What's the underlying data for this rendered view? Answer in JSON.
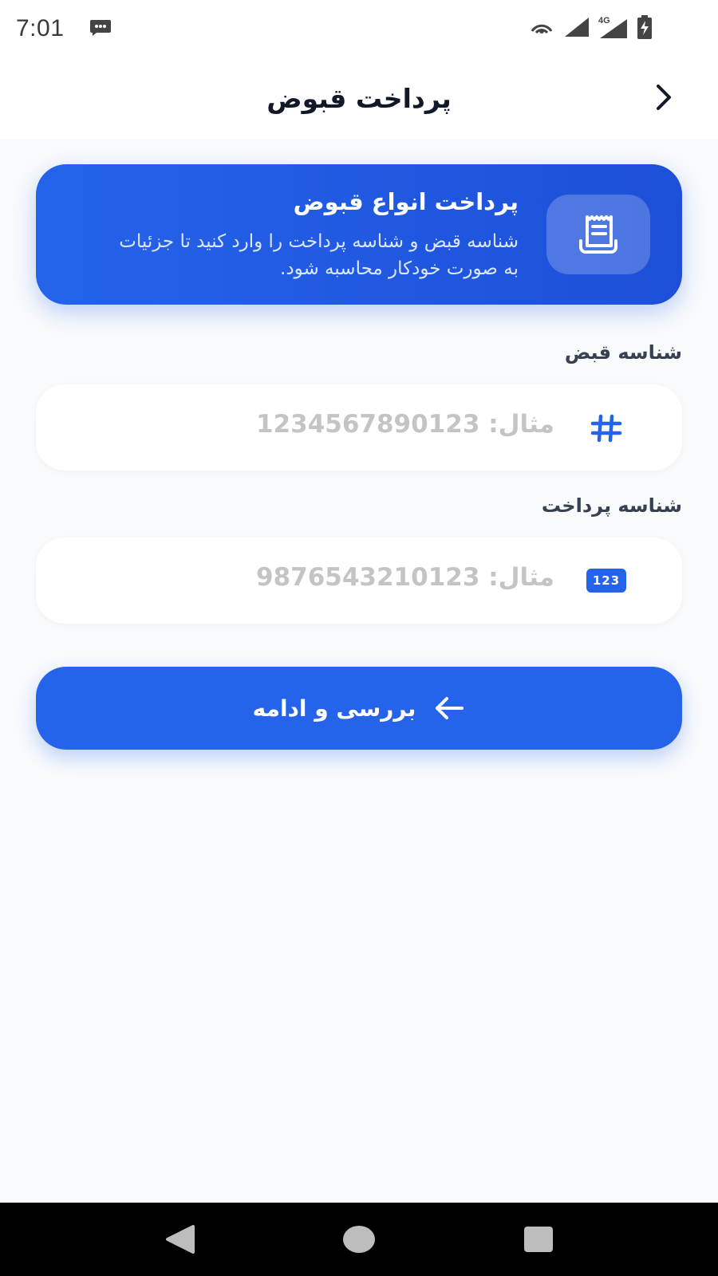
{
  "status_bar": {
    "time": "7:01",
    "network_label": "4G",
    "icons": [
      "message-icon",
      "hotspot-icon",
      "signal-icon",
      "battery-charging-icon"
    ]
  },
  "app_bar": {
    "title": "پرداخت قبوض",
    "back_icon": "chevron-right-icon"
  },
  "info_card": {
    "icon": "receipt-icon",
    "title": "پرداخت انواع قبوض",
    "description": "شناسه قبض و شناسه پرداخت را وارد کنید تا جزئیات به صورت خودکار محاسبه شود."
  },
  "form": {
    "bill_id": {
      "label": "شناسه قبض",
      "value": "",
      "placeholder": "مثال: 1234567890123",
      "icon": "hash-icon"
    },
    "payment_id": {
      "label": "شناسه پرداخت",
      "value": "",
      "placeholder": "مثال: 9876543210123",
      "icon": "numbers-icon",
      "icon_text": "123"
    },
    "submit": {
      "label": "بررسی و ادامه",
      "icon": "arrow-left-icon"
    }
  },
  "nav_bar": {
    "icons": [
      "nav-back-icon",
      "nav-home-icon",
      "nav-recents-icon"
    ]
  },
  "colors": {
    "primary": "#2563eb",
    "background": "#f8fafc",
    "surface": "#ffffff",
    "title_text": "#111827",
    "label_text": "#374151",
    "placeholder": "#c4c4c4"
  }
}
